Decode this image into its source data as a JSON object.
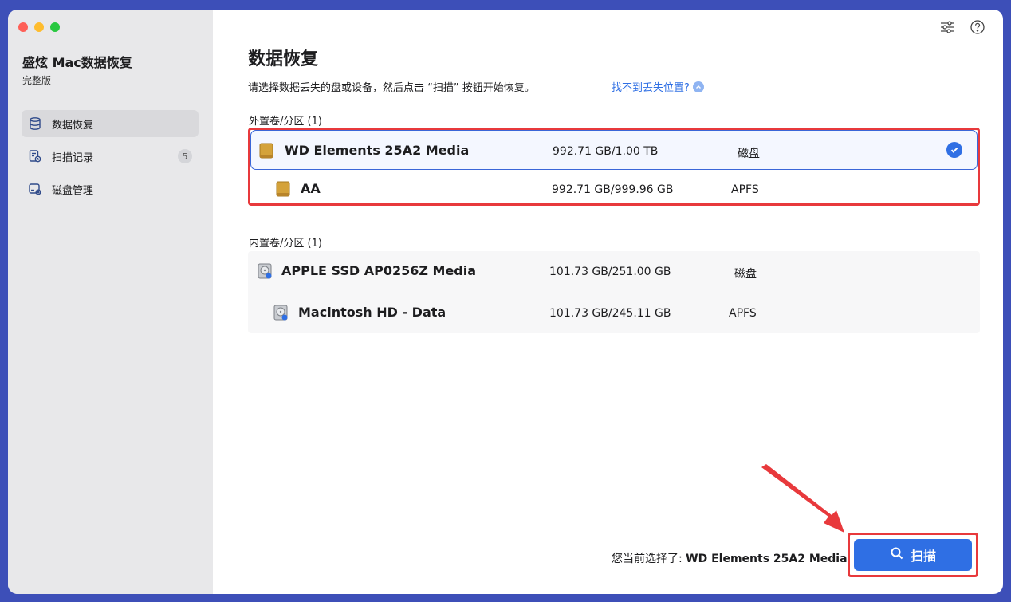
{
  "sidebar": {
    "app_title": "盛炫 Mac数据恢复",
    "edition": "完整版",
    "items": [
      {
        "label": "数据恢复",
        "icon": "database-icon",
        "active": true
      },
      {
        "label": "扫描记录",
        "icon": "scan-history-icon",
        "badge": "5"
      },
      {
        "label": "磁盘管理",
        "icon": "disk-manage-icon"
      }
    ]
  },
  "header": {
    "icons": [
      "settings-sliders-icon",
      "help-icon"
    ]
  },
  "main": {
    "title": "数据恢复",
    "description": "请选择数据丢失的盘或设备，然后点击 “扫描” 按钮开始恢复。",
    "help_link": "找不到丢失位置?",
    "external": {
      "title": "外置卷/分区 (1)",
      "rows": [
        {
          "name": "WD Elements 25A2 Media",
          "size": "992.71 GB/1.00 TB",
          "type": "磁盘",
          "selected": true
        },
        {
          "name": "AA",
          "size": "992.71 GB/999.96 GB",
          "type": "APFS"
        }
      ]
    },
    "internal": {
      "title": "内置卷/分区 (1)",
      "rows": [
        {
          "name": "APPLE SSD AP0256Z Media",
          "size": "101.73 GB/251.00 GB",
          "type": "磁盘"
        },
        {
          "name": "Macintosh HD - Data",
          "size": "101.73 GB/245.11 GB",
          "type": "APFS"
        }
      ]
    }
  },
  "footer": {
    "selection_prefix": "您当前选择了: ",
    "selection_value": "WD Elements 25A2 Media",
    "scan_label": "扫描"
  },
  "colors": {
    "accent": "#2f6fe4",
    "highlight": "#e8393c",
    "sidebar_bg": "#e8e8ea"
  }
}
